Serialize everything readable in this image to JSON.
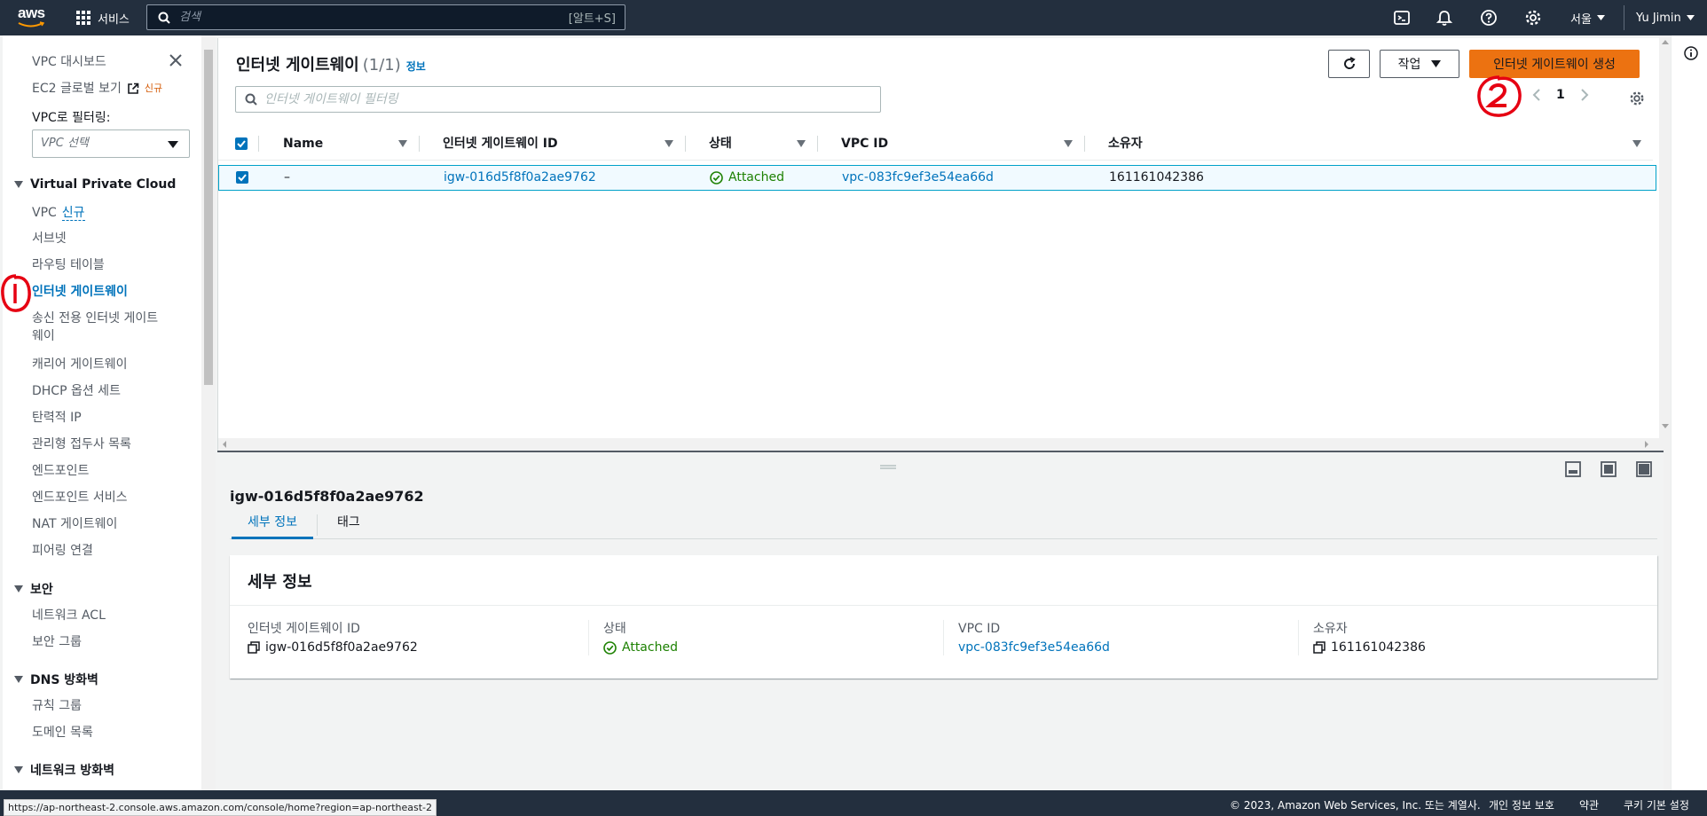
{
  "topnav": {
    "logo_text": "aws",
    "services_label": "서비스",
    "search_placeholder": "검색",
    "search_shortcut": "[알트+S]",
    "region": "서울",
    "user": "Yu Jimin"
  },
  "sidebar": {
    "dashboard": "VPC 대시보드",
    "ec2_global": "EC2 글로벌 보기",
    "new_tag": "신규",
    "filter_label": "VPC로 필터링:",
    "vpc_select": "VPC 선택",
    "section_vpc": "Virtual Private Cloud",
    "vpc_items": [
      {
        "label": "VPC"
      },
      {
        "label": "서브넷"
      },
      {
        "label": "라우팅 테이블"
      },
      {
        "label": "인터넷 게이트웨이"
      },
      {
        "label_line1": "송신 전용 인터넷 게이트",
        "label_line2": "웨이"
      },
      {
        "label": "캐리어 게이트웨이"
      },
      {
        "label": "DHCP 옵션 세트"
      },
      {
        "label": "탄력적 IP"
      },
      {
        "label": "관리형 접두사 목록"
      },
      {
        "label": "엔드포인트"
      },
      {
        "label": "엔드포인트 서비스"
      },
      {
        "label": "NAT 게이트웨이"
      },
      {
        "label": "피어링 연결"
      }
    ],
    "vpc_new_tag": "신규",
    "section_security": "보안",
    "security_items": [
      "네트워크 ACL",
      "보안 그룹"
    ],
    "section_dns": "DNS 방화벽",
    "dns_items": [
      "규칙 그룹",
      "도메인 목록"
    ],
    "section_network_fw": "네트워크 방화벽"
  },
  "main": {
    "title": "인터넷 게이트웨이",
    "count": "(1/1)",
    "info": "정보",
    "filter_placeholder": "인터넷 게이트웨이 필터링",
    "actions_label": "작업",
    "create_label": "인터넷 게이트웨이 생성",
    "page_number": "1",
    "columns": [
      "Name",
      "인터넷 게이트웨이 ID",
      "상태",
      "VPC ID",
      "소유자"
    ],
    "rows": [
      {
        "name": "–",
        "id": "igw-016d5f8f0a2ae9762",
        "status": "Attached",
        "vpc_id": "vpc-083fc9ef3e54ea66d",
        "owner": "161161042386"
      }
    ]
  },
  "detail": {
    "id": "igw-016d5f8f0a2ae9762",
    "tabs": [
      "세부 정보",
      "태그"
    ],
    "card_title": "세부 정보",
    "fields": [
      {
        "label": "인터넷 게이트웨이 ID",
        "value": "igw-016d5f8f0a2ae9762"
      },
      {
        "label": "상태",
        "value": "Attached"
      },
      {
        "label": "VPC ID",
        "value": "vpc-083fc9ef3e54ea66d"
      },
      {
        "label": "소유자",
        "value": "161161042386"
      }
    ]
  },
  "footer": {
    "copyright": "© 2023, Amazon Web Services, Inc. 또는 계열사.",
    "privacy": "개인 정보 보호",
    "terms": "약관",
    "cookies": "쿠키 기본 설정"
  },
  "status_url": "https://ap-northeast-2.console.aws.amazon.com/console/home?region=ap-northeast-2",
  "annotations": {
    "one": "①",
    "two": "②"
  },
  "colors": {
    "nav_bg": "#232f3e",
    "primary": "#ec7211",
    "link": "#0073bb",
    "success": "#1d8102",
    "annotation": "#e60012"
  }
}
